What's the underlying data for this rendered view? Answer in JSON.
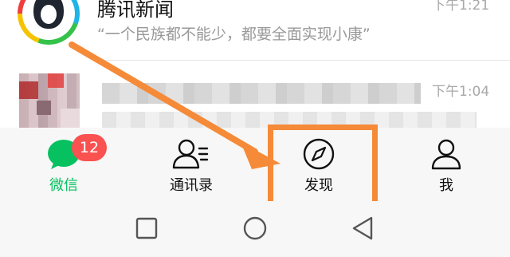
{
  "chats": [
    {
      "name": "腾讯新闻",
      "preview": "“一个民族都不能少，都要全面实现小康”",
      "time": "下午1:21",
      "avatar_icon": "qq-penguin-icon"
    },
    {
      "name": "",
      "preview": "",
      "time": "下午1:04",
      "avatar_icon": "blurred-avatar"
    }
  ],
  "tabbar": {
    "active": "weixin",
    "tabs": [
      {
        "id": "weixin",
        "label": "微信",
        "icon": "chat-bubble-icon",
        "badge": "12"
      },
      {
        "id": "contacts",
        "label": "通讯录",
        "icon": "contacts-icon"
      },
      {
        "id": "discover",
        "label": "发现",
        "icon": "compass-icon"
      },
      {
        "id": "me",
        "label": "我",
        "icon": "person-icon"
      }
    ]
  },
  "annotation": {
    "color": "#f58a38",
    "target": "discover"
  },
  "system_nav": {
    "buttons": [
      "recents-square-icon",
      "home-circle-icon",
      "back-triangle-icon"
    ]
  },
  "colors": {
    "accent": "#07c160",
    "badge": "#fa5151",
    "tabbar_bg": "#f7f7f7"
  }
}
